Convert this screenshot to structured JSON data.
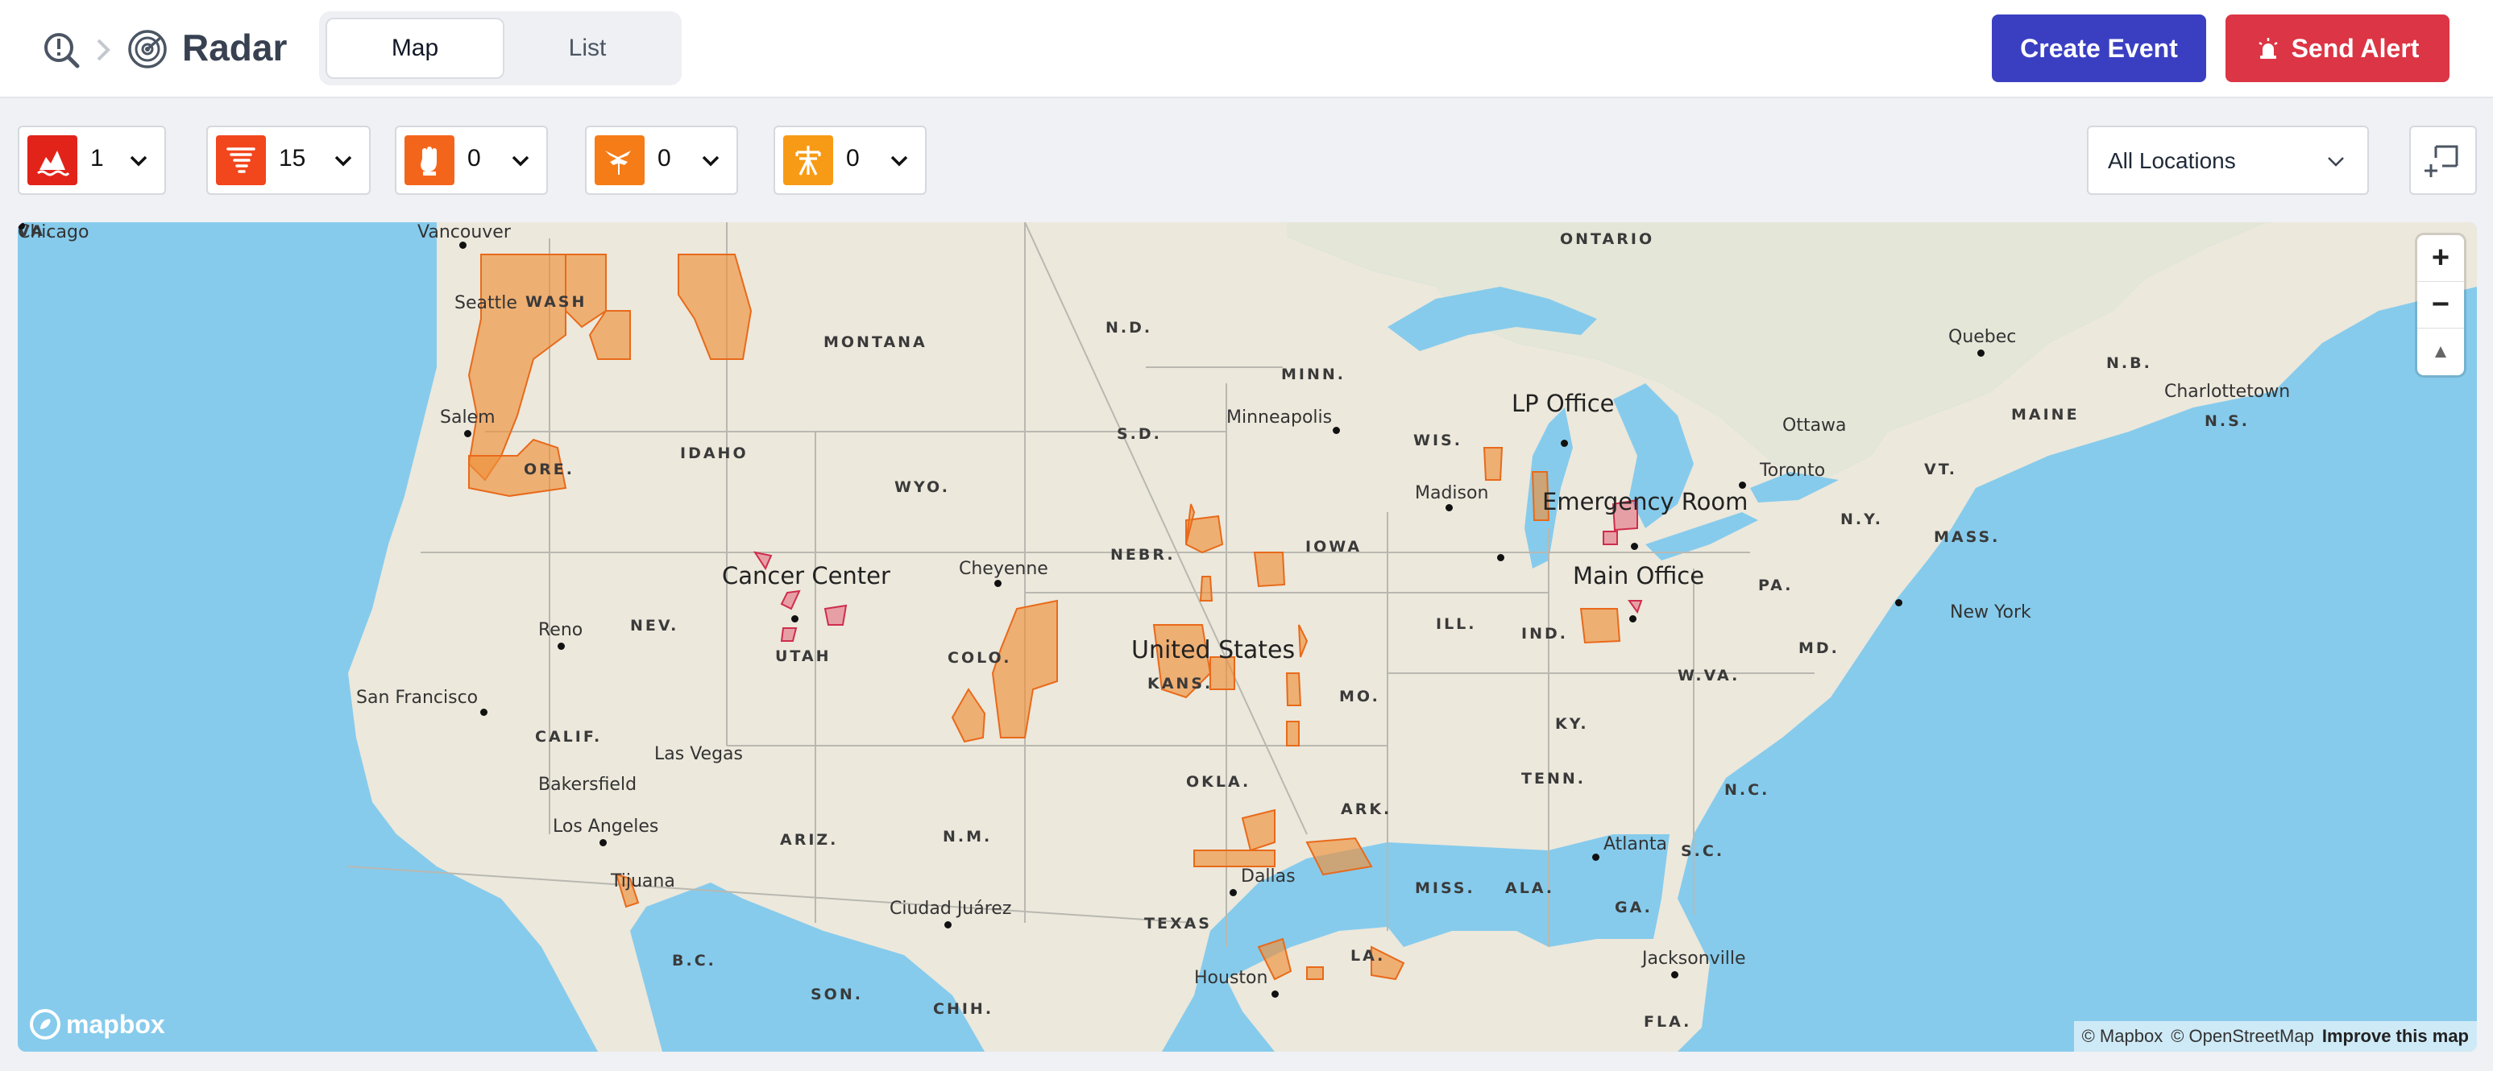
{
  "header": {
    "title": "Radar",
    "tabs": [
      {
        "label": "Map",
        "active": true
      },
      {
        "label": "List",
        "active": false
      }
    ],
    "create_event_label": "Create Event",
    "send_alert_label": "Send Alert",
    "create_color": "#3a3fc2",
    "alert_color": "#dc3545"
  },
  "filters": [
    {
      "icon": "flood-icon",
      "count": "1",
      "color": "#e2231a"
    },
    {
      "icon": "tornado-icon",
      "count": "15",
      "color": "#f2461d"
    },
    {
      "icon": "protest-icon",
      "count": "0",
      "color": "#f4651c"
    },
    {
      "icon": "medical-icon",
      "count": "0",
      "color": "#f57c16"
    },
    {
      "icon": "power-outage-icon",
      "count": "0",
      "color": "#f79b16"
    }
  ],
  "location_filter": {
    "value": "All Locations"
  },
  "map": {
    "country_label": "United States",
    "pois": [
      "LP Office",
      "Emergency Room",
      "Main Office",
      "Cancer Center"
    ],
    "states": [
      "ONTARIO",
      "N.D.",
      "MINN.",
      "MONTANA",
      "WASH",
      "IDAHO",
      "ORE.",
      "WYO.",
      "S.D.",
      "WIS.",
      "NEBR.",
      "IOWA",
      "NEV.",
      "UTAH",
      "COLO.",
      "KANS.",
      "MO.",
      "ILL.",
      "IND.",
      "CALIF.",
      "KY.",
      "W.VA.",
      "VA.",
      "PA.",
      "N.Y.",
      "MASS.",
      "VT.",
      "MAINE",
      "N.B.",
      "N.S.",
      "MD.",
      "TENN.",
      "N.C.",
      "OKLA.",
      "ARK.",
      "S.C.",
      "ARIZ.",
      "N.M.",
      "MISS.",
      "ALA.",
      "GA.",
      "TEXAS",
      "LA.",
      "FLA.",
      "B.C.",
      "SON.",
      "CHIH."
    ],
    "cities": [
      "Vancouver",
      "Seattle",
      "Salem",
      "Minneapolis",
      "Quebec",
      "Charlottetown",
      "Ottawa",
      "Toronto",
      "Madison",
      "Chicago",
      "Cheyenne",
      "Reno",
      "San Francisco",
      "Las Vegas",
      "Bakersfield",
      "Los Angeles",
      "Tijuana",
      "Ciudad Juárez",
      "Dallas",
      "Houston",
      "Atlanta",
      "Jacksonville",
      "New York"
    ],
    "zoom_in": "+",
    "zoom_out": "−",
    "compass": "▲",
    "attribution": {
      "mapbox": "© Mapbox",
      "osm": "© OpenStreetMap",
      "improve": "Improve this map"
    },
    "logo": "mapbox",
    "alert_fill": "#f0903a",
    "poi_fill": "#e2556f"
  }
}
